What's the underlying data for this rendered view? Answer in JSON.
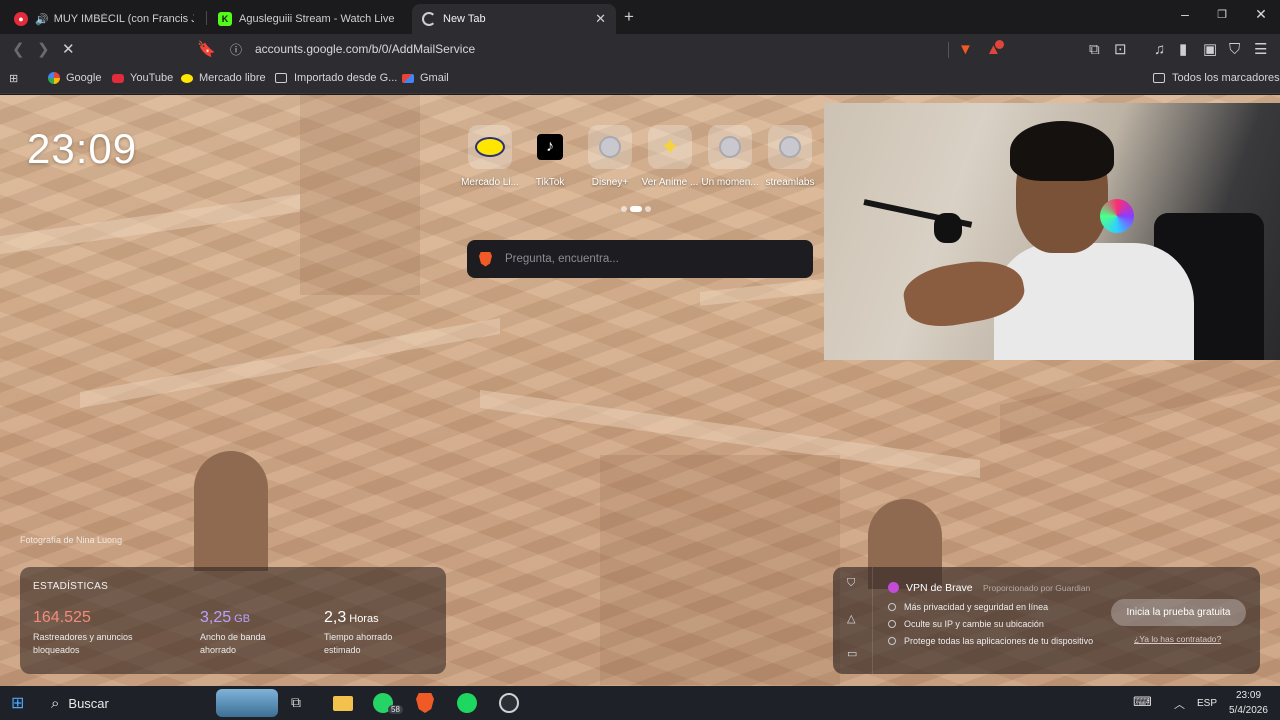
{
  "tabs": [
    {
      "title": "MUY IMBÉCIL (con Francis Jerem",
      "active": false
    },
    {
      "title": "Agusleguiii Stream - Watch Live on K",
      "active": false
    },
    {
      "title": "New Tab",
      "active": true
    }
  ],
  "toolbar": {
    "url": "accounts.google.com/b/0/AddMailService"
  },
  "bookmarks": {
    "items": [
      "Google",
      "YouTube",
      "Mercado libre",
      "Importado desde G...",
      "Gmail"
    ],
    "all_label": "Todos los marcadores"
  },
  "newtab": {
    "clock": "23:09",
    "photo_credit": "Fotografía de Nina Luong",
    "tiles": [
      "Mercado Li...",
      "TikTok",
      "Disney+",
      "Ver Anime ...",
      "Un momen...",
      "streamlabs"
    ],
    "search_placeholder": "Pregunta, encuentra...",
    "stats": {
      "heading": "ESTADÍSTICAS",
      "trackers_value": "164.525",
      "trackers_desc_1": "Rastreadores y anuncios",
      "trackers_desc_2": "bloqueados",
      "bandwidth_value": "3,25",
      "bandwidth_unit": "GB",
      "bandwidth_desc_1": "Ancho de banda",
      "bandwidth_desc_2": "ahorrado",
      "time_value": "2,3",
      "time_unit": "Horas",
      "time_desc_1": "Tiempo ahorrado",
      "time_desc_2": "estimado"
    },
    "vpn": {
      "title": "VPN de Brave",
      "provider": "Proporcionado por Guardian",
      "features": [
        "Más privacidad y seguridad en línea",
        "Oculte su IP y cambie su ubicación",
        "Protege todas las aplicaciones de tu dispositivo"
      ],
      "cta": "Inicia la prueba gratuita",
      "link": "¿Ya lo has contratado?"
    }
  },
  "taskbar": {
    "search": "Buscar",
    "whatsapp_badge": "58",
    "lang": "ESP",
    "time": "23:09",
    "date": "5/4/2026"
  },
  "colors": {
    "trackers": "#f58a7a",
    "bandwidth": "#b9a2ff",
    "time": "#ffffff",
    "brave": "#ef5a27"
  }
}
